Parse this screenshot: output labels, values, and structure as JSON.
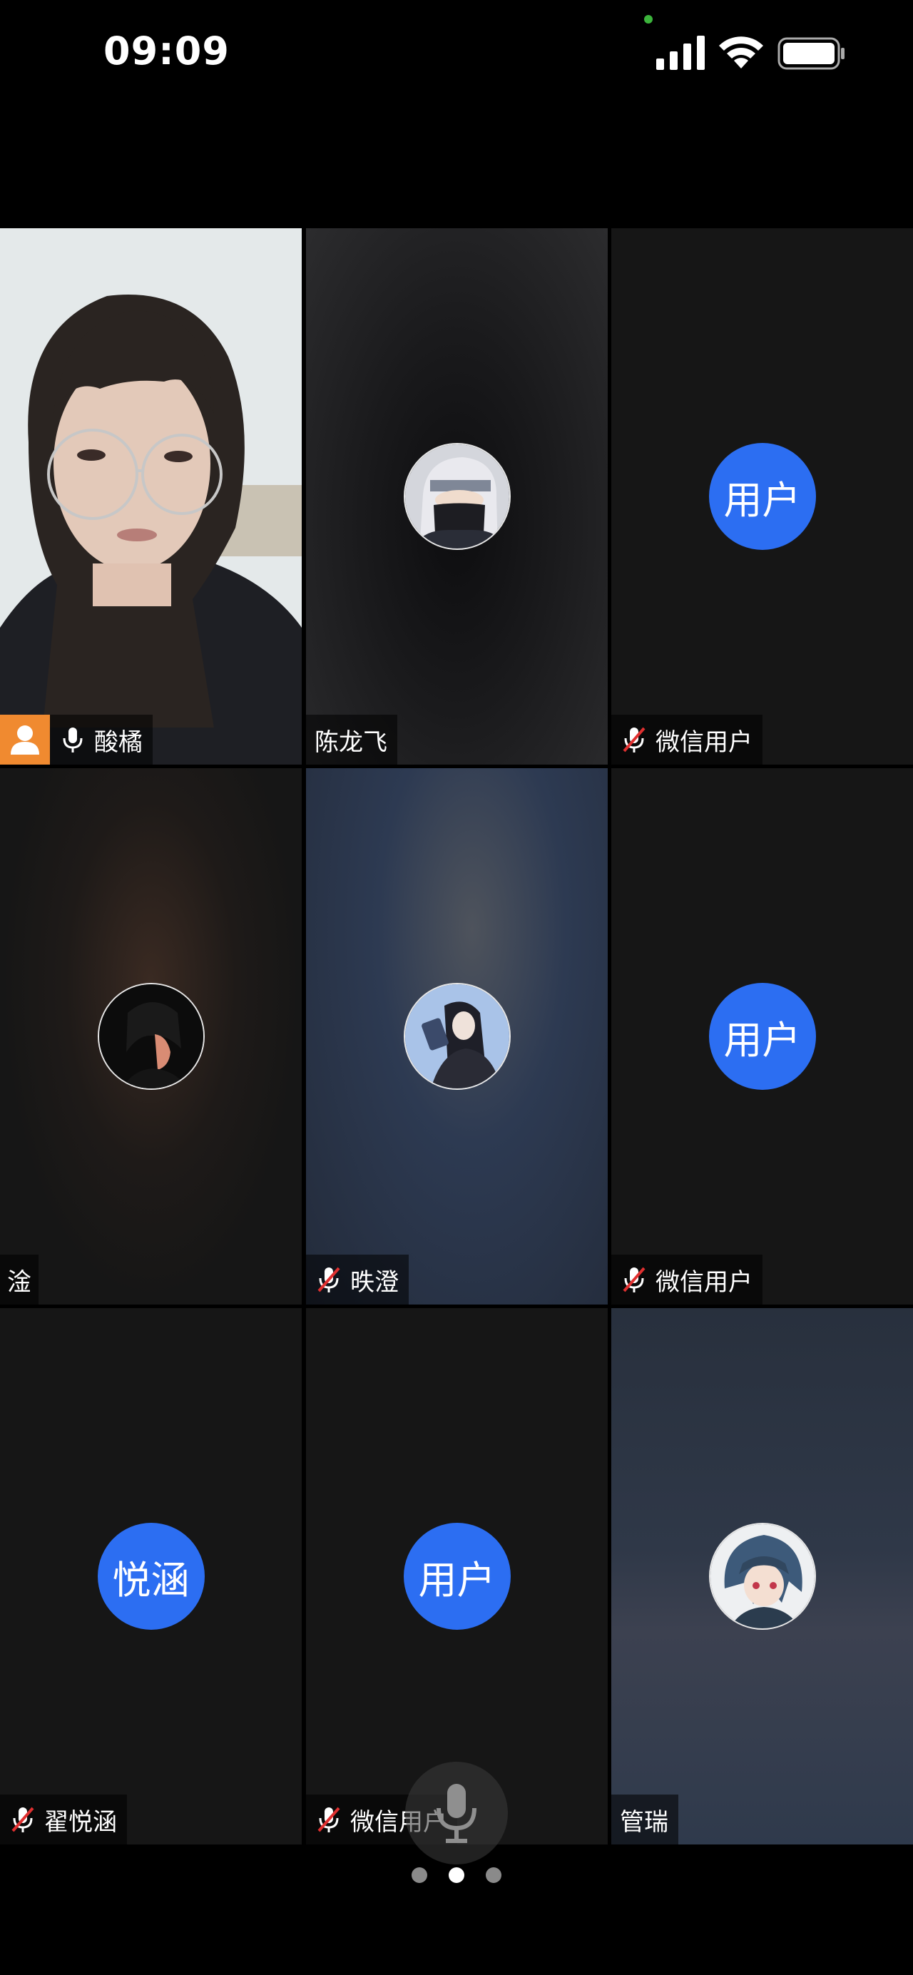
{
  "status_bar": {
    "time": "09:09"
  },
  "participants": [
    {
      "name": "酸橘",
      "type": "video",
      "mic": "on",
      "active": true,
      "host": true
    },
    {
      "name": "陈龙飞",
      "type": "image-avatar",
      "avatar_icon": "masked-ninja-avatar"
    },
    {
      "name": "微信用户",
      "type": "text-avatar",
      "avatar_text": "用户",
      "mic": "muted"
    },
    {
      "name": "淦",
      "type": "image-avatar",
      "avatar_icon": "dark-portrait-avatar"
    },
    {
      "name": "昳澄",
      "type": "image-avatar",
      "avatar_icon": "phone-selfie-avatar",
      "mic": "muted"
    },
    {
      "name": "微信用户",
      "type": "text-avatar",
      "avatar_text": "用户",
      "mic": "muted"
    },
    {
      "name": "翟悦涵",
      "type": "text-avatar",
      "avatar_text": "悦涵",
      "mic": "muted"
    },
    {
      "name": "微信用户",
      "type": "text-avatar",
      "avatar_text": "用户",
      "mic": "muted"
    },
    {
      "name": "管瑞",
      "type": "image-avatar",
      "avatar_icon": "anime-character-avatar"
    }
  ],
  "pager": {
    "pages": 3,
    "current": 2
  },
  "colors": {
    "active_border": "#4cc25a",
    "avatar_blue": "#2c6ef2",
    "host_badge": "#f08a30",
    "muted_slash": "#e03030"
  }
}
